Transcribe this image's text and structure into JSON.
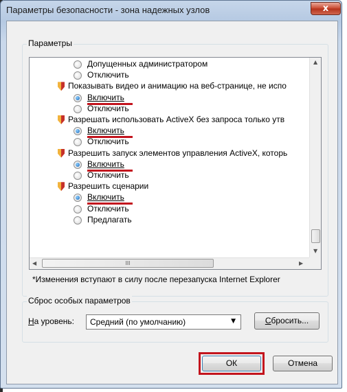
{
  "window": {
    "title": "Параметры безопасности - зона надежных узлов",
    "close_label": "x"
  },
  "settings_group": {
    "label": "Параметры",
    "rows": [
      {
        "type": "radio",
        "checked": false,
        "label": "Допущенных администратором",
        "highlight": false
      },
      {
        "type": "radio",
        "checked": false,
        "label": "Отключить",
        "highlight": false
      },
      {
        "type": "heading",
        "label": "Показывать видео и анимацию на веб-странице, не испо"
      },
      {
        "type": "radio",
        "checked": true,
        "label": "Включить",
        "highlight": true
      },
      {
        "type": "radio",
        "checked": false,
        "label": "Отключить",
        "highlight": false
      },
      {
        "type": "heading",
        "label": "Разрешать использовать ActiveX без запроса только утв"
      },
      {
        "type": "radio",
        "checked": true,
        "label": "Включить",
        "highlight": true
      },
      {
        "type": "radio",
        "checked": false,
        "label": "Отключить",
        "highlight": false
      },
      {
        "type": "heading",
        "label": "Разрешить запуск элементов управления ActiveX, которь"
      },
      {
        "type": "radio",
        "checked": true,
        "label": "Включить",
        "highlight": true
      },
      {
        "type": "radio",
        "checked": false,
        "label": "Отключить",
        "highlight": false
      },
      {
        "type": "heading",
        "label": "Разрешить сценарии"
      },
      {
        "type": "radio",
        "checked": true,
        "label": "Включить",
        "highlight": true
      },
      {
        "type": "radio",
        "checked": false,
        "label": "Отключить",
        "highlight": false
      },
      {
        "type": "radio",
        "checked": false,
        "label": "Предлагать",
        "highlight": false
      }
    ],
    "hscroll_grip": "III",
    "note": "*Изменения вступают в силу после перезапуска Internet Explorer"
  },
  "reset_group": {
    "label": "Сброс особых параметров",
    "level_label_underlined": "Н",
    "level_label_rest": "а уровень:",
    "level_value": "Средний (по умолчанию)",
    "reset_button_underlined": "С",
    "reset_button_rest": "бросить..."
  },
  "buttons": {
    "ok": "ОК",
    "cancel": "Отмена"
  },
  "colors": {
    "highlight": "#c3141d",
    "title_bar": "#b5c9e2"
  }
}
